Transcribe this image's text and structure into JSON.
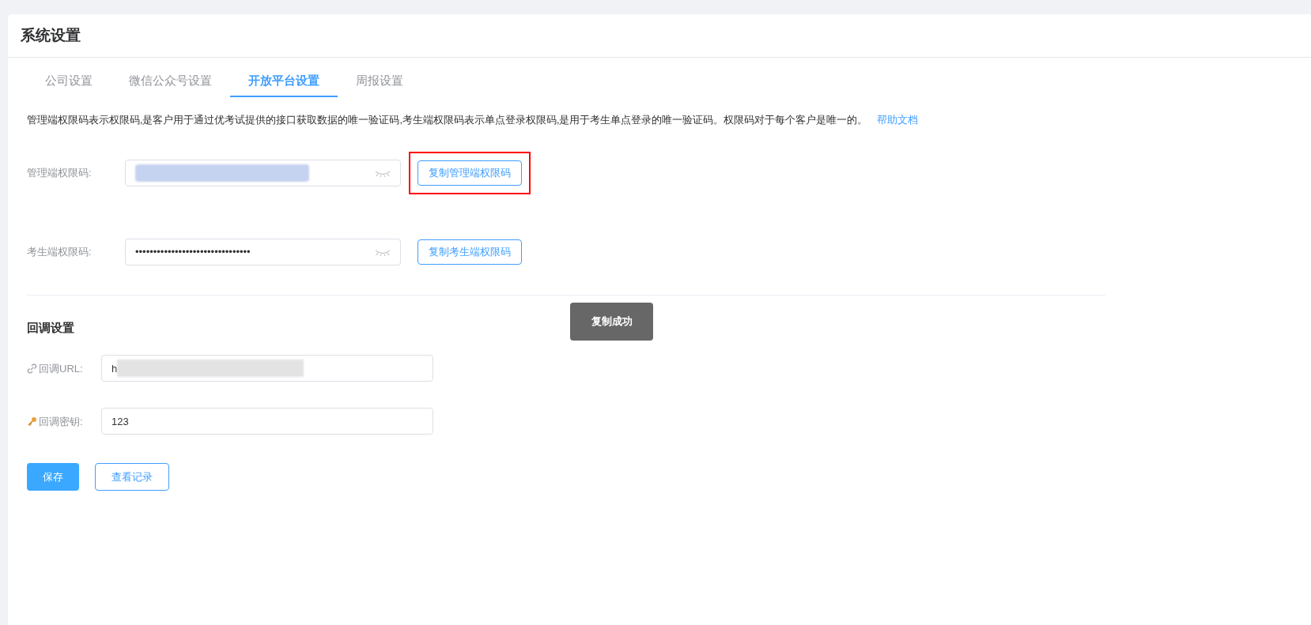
{
  "page_title": "系统设置",
  "tabs": [
    {
      "label": "公司设置",
      "selected": false
    },
    {
      "label": "微信公众号设置",
      "selected": false
    },
    {
      "label": "开放平台设置",
      "selected": true
    },
    {
      "label": "周报设置",
      "selected": false
    }
  ],
  "description": "管理端权限码表示权限码,是客户用于通过优考试提供的接口获取数据的唯一验证码,考生端权限码表示单点登录权限码,是用于考生单点登录的唯一验证码。权限码对于每个客户是唯一的。",
  "help_link": "帮助文档",
  "codes": [
    {
      "label": "管理端权限码:",
      "redacted": true,
      "button": "复制管理端权限码",
      "highlighted": true
    },
    {
      "label": "考生端权限码:",
      "value": "••••••••••••••••••••••••••••••••",
      "redacted": false,
      "button": "复制考生端权限码",
      "highlighted": false
    }
  ],
  "callback": {
    "title": "回调设置",
    "fields": [
      {
        "kind": "link",
        "label": "回调URL:",
        "value": "h",
        "redacted": true
      },
      {
        "kind": "key",
        "label": "回调密钥:",
        "value": "123",
        "redacted": false
      }
    ]
  },
  "buttons": [
    {
      "label": "保存",
      "kind": "primary"
    },
    {
      "label": "查看记录",
      "kind": "secondary"
    }
  ],
  "toast": "复制成功"
}
